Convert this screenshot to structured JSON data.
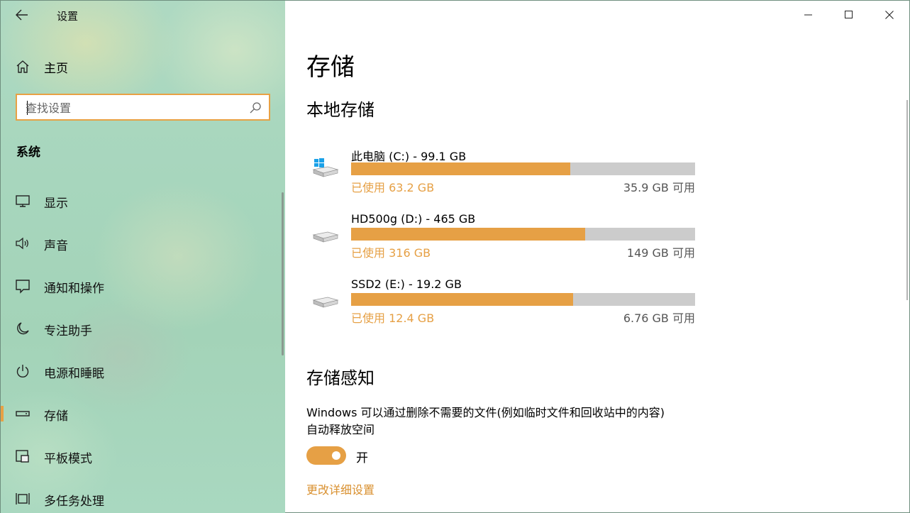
{
  "window": {
    "title": "设置"
  },
  "sidebar": {
    "home_label": "主页",
    "search_placeholder": "查找设置",
    "section_header": "系统",
    "items": [
      {
        "label": "显示",
        "icon": "monitor-icon"
      },
      {
        "label": "声音",
        "icon": "speaker-icon"
      },
      {
        "label": "通知和操作",
        "icon": "notification-icon"
      },
      {
        "label": "专注助手",
        "icon": "moon-icon"
      },
      {
        "label": "电源和睡眠",
        "icon": "power-icon"
      },
      {
        "label": "存储",
        "icon": "storage-icon",
        "selected": true
      },
      {
        "label": "平板模式",
        "icon": "tablet-icon"
      },
      {
        "label": "多任务处理",
        "icon": "multitask-icon"
      }
    ]
  },
  "main": {
    "title": "存储",
    "local_storage_header": "本地存储",
    "drives": [
      {
        "name": "此电脑 (C:) - 99.1 GB",
        "used": "已使用 63.2 GB",
        "free": "35.9 GB 可用",
        "used_fraction": 0.638,
        "icon": "windows-drive-icon"
      },
      {
        "name": "HD500g (D:) - 465 GB",
        "used": "已使用 316 GB",
        "free": "149 GB 可用",
        "used_fraction": 0.68,
        "icon": "drive-icon"
      },
      {
        "name": "SSD2 (E:) - 19.2 GB",
        "used": "已使用 12.4 GB",
        "free": "6.76 GB 可用",
        "used_fraction": 0.646,
        "icon": "drive-icon"
      }
    ],
    "storage_sense_header": "存储感知",
    "storage_sense_desc_line1": "Windows 可以通过删除不需要的文件(例如临时文件和回收站中的内容)",
    "storage_sense_desc_line2": "自动释放空间",
    "toggle_state_label": "开",
    "toggle_on": true,
    "change_settings_link": "更改详细设置"
  },
  "colors": {
    "accent": "#e6a045",
    "bar_background": "#cccccc",
    "sidebar_bg": "#a7d6bd"
  }
}
